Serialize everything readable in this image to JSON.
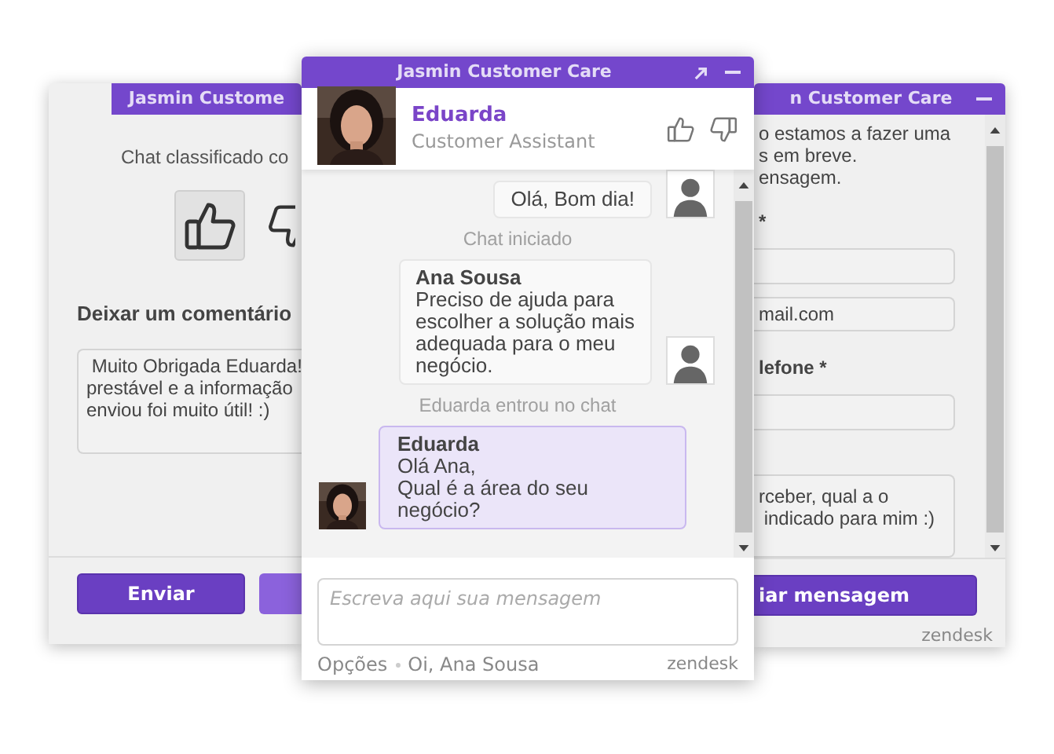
{
  "left_window": {
    "title": "Jasmin Custome",
    "rating_prompt": "Chat classificado co",
    "rating": [
      {
        "kind": "up",
        "selected": true
      },
      {
        "kind": "down",
        "selected": false
      }
    ],
    "comment_label": "Deixar um comentário",
    "comment": " Muito Obrigada Eduarda!\nprestável e a informação\nenviou foi muito útil! :)",
    "submit": "Enviar"
  },
  "chat_window": {
    "title": "Jasmin Customer Care",
    "agent": {
      "name": "Eduarda",
      "role": "Customer Assistant"
    },
    "messages": [
      {
        "kind": "visitor",
        "text": "Olá, Bom dia!"
      },
      {
        "kind": "system",
        "text": "Chat iniciado"
      },
      {
        "kind": "visitor",
        "sender": "Ana Sousa",
        "text": "Preciso de ajuda para\nescolher a solução mais\nadequada para o meu\nnegócio."
      },
      {
        "kind": "system",
        "text": "Eduarda entrou no chat"
      },
      {
        "kind": "agent",
        "sender": "Eduarda",
        "text": "Olá Ana,\nQual é a área do seu\nnegócio?"
      }
    ],
    "input": {
      "placeholder": "Escreva aqui sua mensagem"
    },
    "footer": {
      "options": "Opções",
      "greeting": "Oi, Ana Sousa",
      "brand": "zendesk"
    }
  },
  "right_window": {
    "title": "n Customer Care",
    "intro": "o estamos a fazer uma\ns em breve.\nensagem.",
    "form": [
      {
        "kind": "label",
        "text": "*"
      },
      {
        "kind": "input"
      },
      {
        "kind": "input",
        "value": "mail.com"
      },
      {
        "kind": "label",
        "text": "lefone *"
      },
      {
        "kind": "input"
      },
      {
        "kind": "textarea",
        "value": "rceber, qual a o\n indicado para mim :)"
      }
    ],
    "submit": "iar mensagem",
    "brand": "zendesk"
  }
}
